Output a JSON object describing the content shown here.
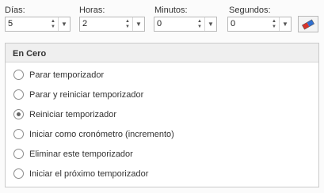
{
  "fields": [
    {
      "label": "Días:",
      "value": "5"
    },
    {
      "label": "Horas:",
      "value": "2"
    },
    {
      "label": "Minutos:",
      "value": "0"
    },
    {
      "label": "Segundos:",
      "value": "0"
    }
  ],
  "group": {
    "title": "En Cero",
    "options": [
      {
        "label": "Parar temporizador",
        "checked": false
      },
      {
        "label": "Parar y reiniciar temporizador",
        "checked": false
      },
      {
        "label": "Reiniciar temporizador",
        "checked": true
      },
      {
        "label": "Iniciar como cronómetro (incremento)",
        "checked": false
      },
      {
        "label": "Eliminar este temporizador",
        "checked": false
      },
      {
        "label": "Iniciar el próximo temporizador",
        "checked": false
      }
    ]
  },
  "icons": {
    "reset": "eraser-icon"
  }
}
